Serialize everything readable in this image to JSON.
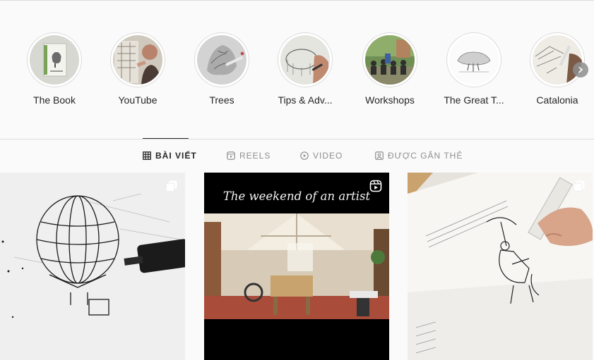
{
  "highlights": [
    {
      "label": "The Book",
      "icon": "book-cover-thumb"
    },
    {
      "label": "YouTube",
      "icon": "artist-drawing-thumb"
    },
    {
      "label": "Trees",
      "icon": "tree-sketch-thumb"
    },
    {
      "label": "Tips & Adv...",
      "icon": "sketchbook-thumb"
    },
    {
      "label": "Workshops",
      "icon": "workshop-group-thumb"
    },
    {
      "label": "The Great T...",
      "icon": "great-tree-thumb"
    },
    {
      "label": "Catalonia",
      "icon": "catalonia-sketch-thumb"
    }
  ],
  "tabs": [
    {
      "label": "BÀI VIẾT",
      "icon": "grid-icon",
      "active": true
    },
    {
      "label": "REELS",
      "icon": "reels-icon",
      "active": false
    },
    {
      "label": "VIDEO",
      "icon": "video-icon",
      "active": false
    },
    {
      "label": "ĐƯỢC GẮN THẺ",
      "icon": "tagged-icon",
      "active": false
    }
  ],
  "posts": [
    {
      "type": "carousel",
      "icon": "carousel-icon"
    },
    {
      "type": "reel",
      "icon": "reel-icon",
      "title": "The weekend of an artist"
    },
    {
      "type": "carousel",
      "icon": "carousel-icon"
    }
  ],
  "colors": {
    "active_text": "#262626",
    "muted_text": "#8e8e8e",
    "border": "#dbdbdb",
    "background": "#fafafa"
  }
}
